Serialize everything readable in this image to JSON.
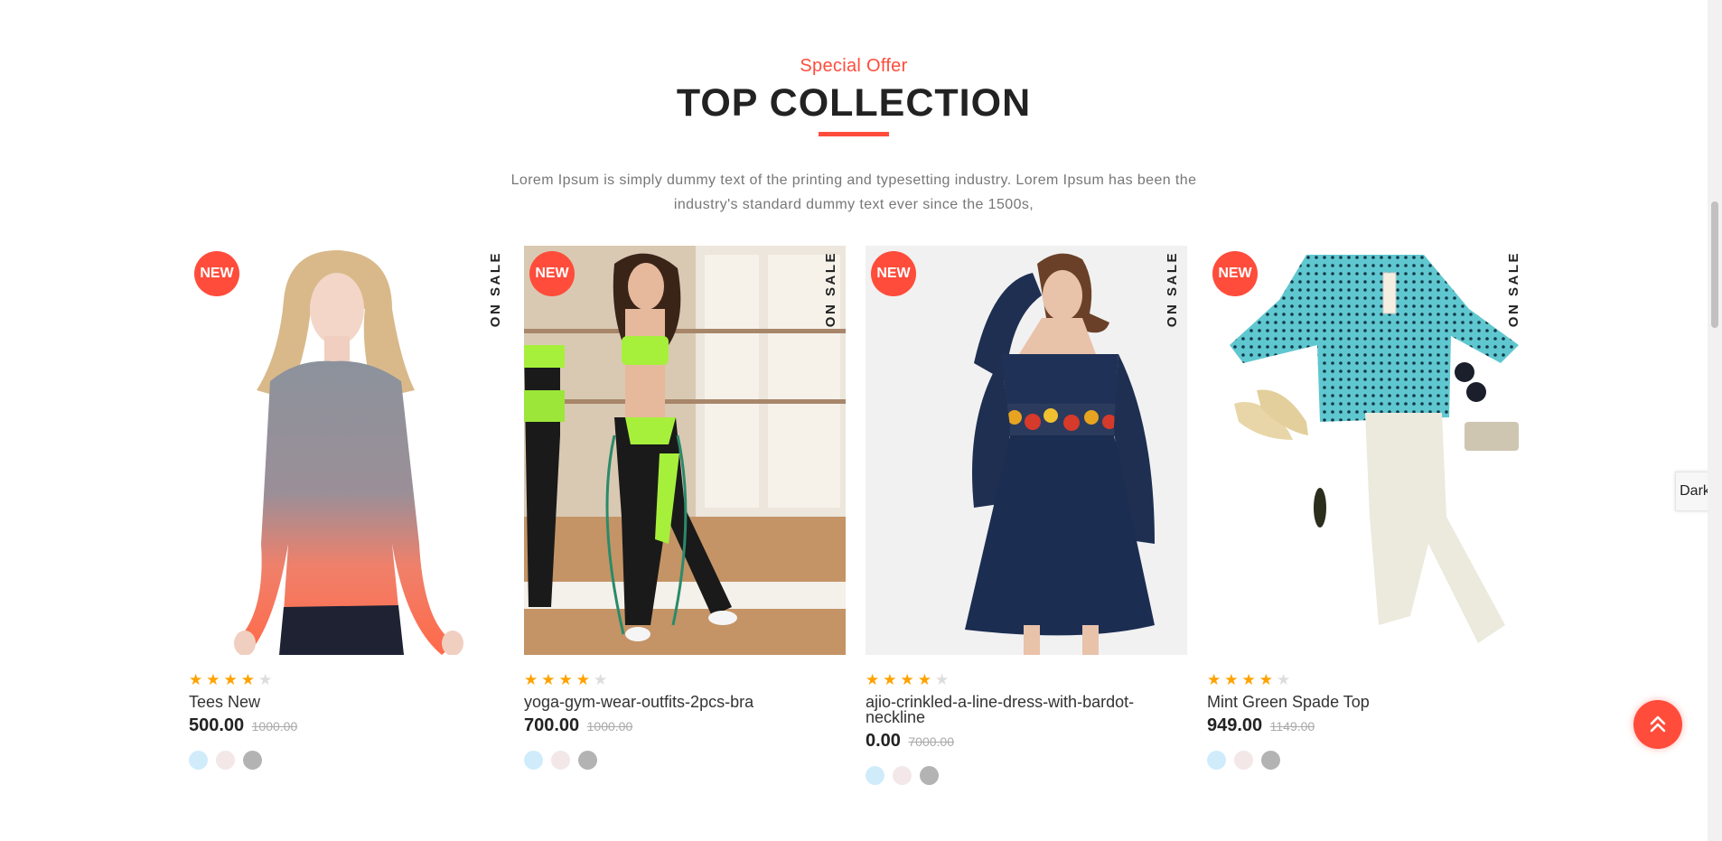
{
  "section": {
    "subtitle": "Special Offer",
    "title": "TOP COLLECTION",
    "description": "Lorem Ipsum is simply dummy text of the printing and typesetting industry. Lorem Ipsum has been the industry's standard dummy text ever since the 1500s,"
  },
  "products": [
    {
      "badge_new": "NEW",
      "badge_sale": "ON SALE",
      "image": "grey-coral-long-sleeve-top",
      "rating": 4,
      "max_rating": 5,
      "name": "Tees New",
      "price": "500.00",
      "old_price": "1000.00",
      "swatches": [
        "#d0ecfb",
        "#f3e7e7",
        "#b3b3b3"
      ]
    },
    {
      "badge_new": "NEW",
      "badge_sale": "ON SALE",
      "image": "yoga-gym-outfit-photo",
      "rating": 4,
      "max_rating": 5,
      "name": "yoga-gym-wear-outfits-2pcs-bra",
      "price": "700.00",
      "old_price": "1000.00",
      "swatches": [
        "#d0ecfb",
        "#f3e7e7",
        "#b3b3b3"
      ]
    },
    {
      "badge_new": "NEW",
      "badge_sale": "ON SALE",
      "image": "navy-embroidered-bardot-dress",
      "rating": 4,
      "max_rating": 5,
      "name": "ajio-crinkled-a-line-dress-with-bardot-neckline",
      "price": "0.00",
      "old_price": "7000.00",
      "swatches": [
        "#d0ecfb",
        "#f3e7e7",
        "#b3b3b3"
      ]
    },
    {
      "badge_new": "NEW",
      "badge_sale": "ON SALE",
      "image": "mint-spade-top-flatlay",
      "rating": 4,
      "max_rating": 5,
      "name": "Mint Green Spade Top",
      "price": "949.00",
      "old_price": "1149.00",
      "swatches": [
        "#d0ecfb",
        "#f3e7e7",
        "#b3b3b3"
      ]
    }
  ],
  "widgets": {
    "dark_toggle_label": "Dark",
    "tap_top_icon": "double-chevron-up-icon"
  },
  "colors": {
    "accent": "#ff4c3b",
    "star": "#ffa200",
    "star_empty": "#dddddd"
  }
}
